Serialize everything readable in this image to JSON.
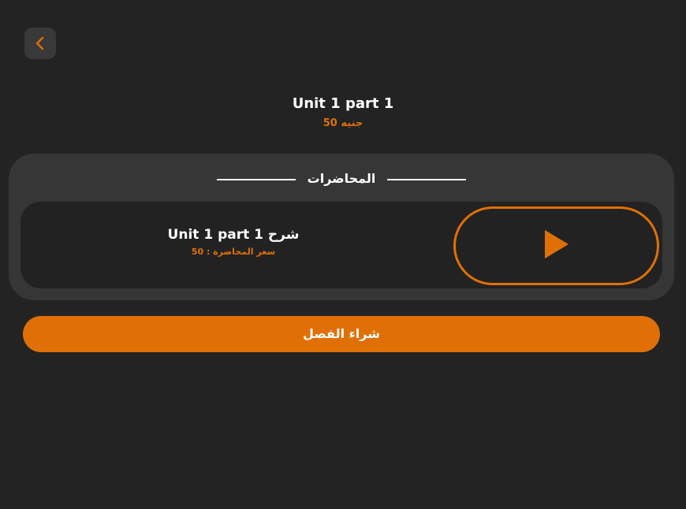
{
  "header": {
    "title": "Unit 1 part 1",
    "price": "50 جنيه"
  },
  "lectures_section": {
    "title": "المحاضرات",
    "lectures": [
      {
        "title": "شرح Unit 1 part 1",
        "price": "سعر المحاضرة : 50",
        "action_icon": "play-icon"
      }
    ]
  },
  "actions": {
    "back_icon": "chevron-left-icon",
    "buy_label": "شراء الفصل"
  },
  "colors": {
    "background": "#232323",
    "panel": "#363636",
    "card": "#222222",
    "accent": "#e07006",
    "text": "#ffffff"
  }
}
